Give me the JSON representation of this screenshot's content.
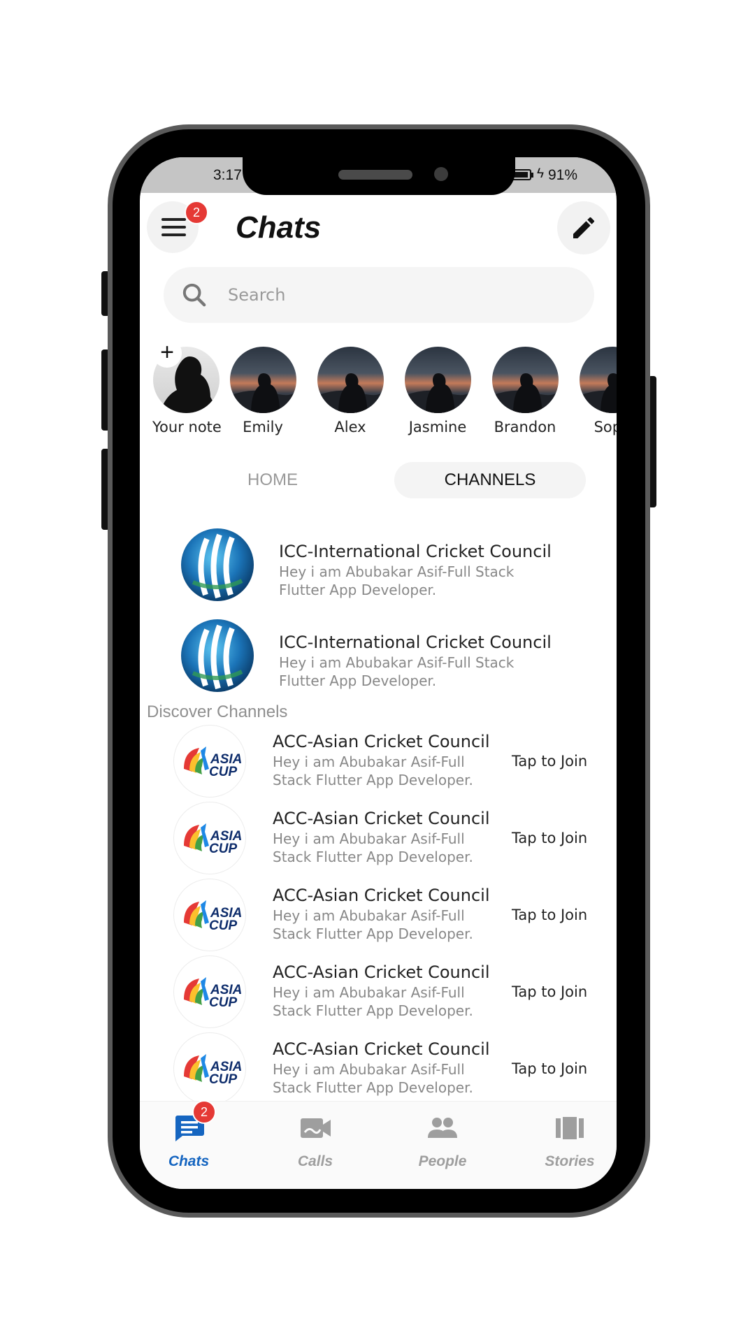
{
  "status": {
    "time": "3:17",
    "battery": "91%"
  },
  "header": {
    "title": "Chats",
    "menu_badge": "2"
  },
  "search": {
    "placeholder": "Search"
  },
  "notes": [
    {
      "label": "Your note"
    },
    {
      "label": "Emily"
    },
    {
      "label": "Alex"
    },
    {
      "label": "Jasmine"
    },
    {
      "label": "Brandon"
    },
    {
      "label": "Soph"
    }
  ],
  "tabs": {
    "home": "HOME",
    "channels": "CHANNELS"
  },
  "channels": [
    {
      "name": "ICC-International Cricket Council",
      "desc": "Hey i am Abubakar Asif-Full Stack Flutter App Developer."
    },
    {
      "name": "ICC-International Cricket Council",
      "desc": "Hey i am Abubakar Asif-Full Stack Flutter App Developer."
    }
  ],
  "discover": {
    "title": "Discover Channels",
    "logo_text_1": "ASIA",
    "logo_text_2": "CUP",
    "items": [
      {
        "name": "ACC-Asian Cricket Council",
        "desc": "Hey i am Abubakar Asif-Full Stack Flutter App Developer.",
        "action": "Tap to Join"
      },
      {
        "name": "ACC-Asian Cricket Council",
        "desc": "Hey i am Abubakar Asif-Full Stack Flutter App Developer.",
        "action": "Tap to Join"
      },
      {
        "name": "ACC-Asian Cricket Council",
        "desc": "Hey i am Abubakar Asif-Full Stack Flutter App Developer.",
        "action": "Tap to Join"
      },
      {
        "name": "ACC-Asian Cricket Council",
        "desc": "Hey i am Abubakar Asif-Full Stack Flutter App Developer.",
        "action": "Tap to Join"
      },
      {
        "name": "ACC-Asian Cricket Council",
        "desc": "Hey i am Abubakar Asif-Full Stack Flutter App Developer.",
        "action": "Tap to Join"
      }
    ]
  },
  "bottom_nav": {
    "chats": "Chats",
    "chats_badge": "2",
    "calls": "Calls",
    "people": "People",
    "stories": "Stories"
  },
  "colors": {
    "accent": "#1565c0",
    "badge": "#e53935",
    "inactive": "#9e9e9e"
  },
  "icons": [
    "menu-icon",
    "edit-icon",
    "search-icon",
    "chat-icon",
    "video-call-icon",
    "people-icon",
    "stories-icon"
  ]
}
